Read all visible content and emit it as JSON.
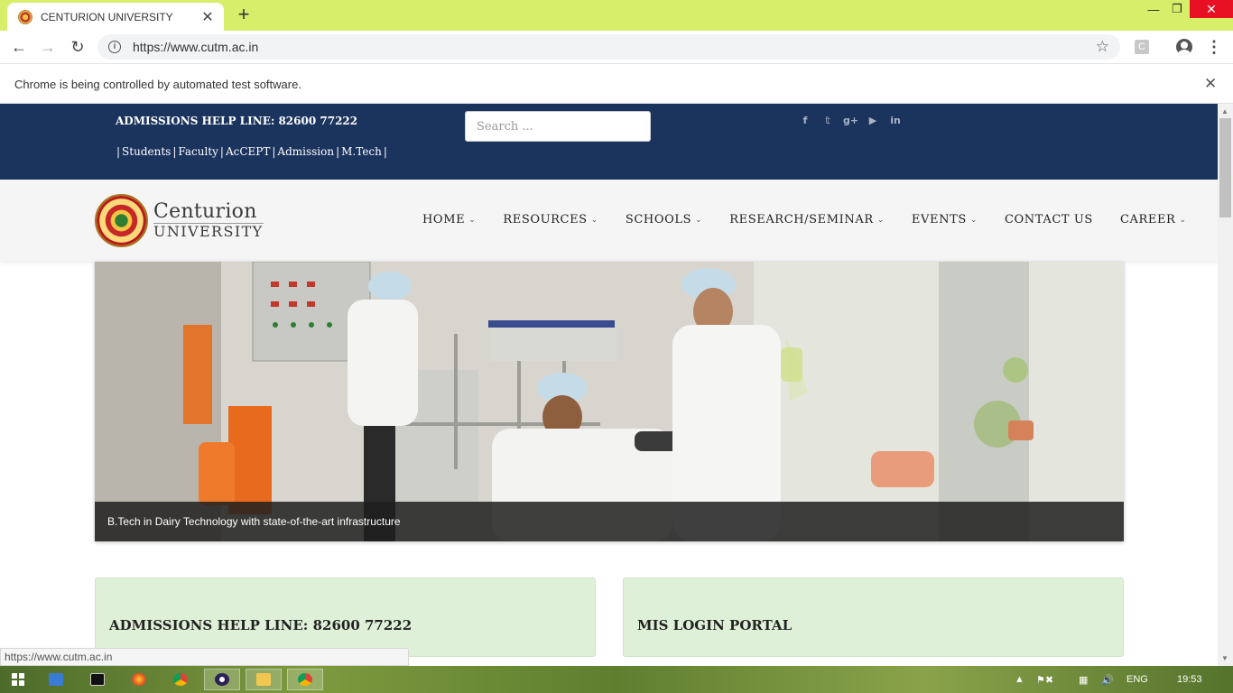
{
  "browser": {
    "tab_title": "CENTURION UNIVERSITY",
    "tab_close": "✕",
    "new_tab": "+",
    "url": "https://www.cutm.ac.in",
    "infobar_text": "Chrome is being controlled by automated test software.",
    "status_url": "https://www.cutm.ac.in",
    "extension_letter": "C"
  },
  "site": {
    "helpline": "ADMISSIONS HELP LINE: 82600 77222",
    "quick_links": [
      "Students",
      "Faculty",
      "AcCEPT",
      "Admission",
      "M.Tech"
    ],
    "search_placeholder": "Search ...",
    "social_icons": [
      "facebook-icon",
      "twitter-icon",
      "google-plus-icon",
      "youtube-icon",
      "linkedin-icon"
    ],
    "logo": {
      "line1": "Centurion",
      "line2": "UNIVERSITY"
    },
    "menu": [
      "HOME",
      "RESOURCES",
      "SCHOOLS",
      "RESEARCH/SEMINAR",
      "EVENTS",
      "CONTACT US",
      "CAREER"
    ],
    "menu_has_dropdown": [
      true,
      true,
      true,
      true,
      true,
      false,
      true
    ],
    "hero_caption": "B.Tech in Dairy Technology with state-of-the-art infrastructure",
    "cards": [
      {
        "title": "ADMISSIONS HELP LINE: 82600 77222"
      },
      {
        "title": "MIS LOGIN PORTAL"
      }
    ],
    "colors": {
      "topbar": "#1b345e",
      "card_bg": "#dff0d8"
    }
  },
  "taskbar": {
    "language": "ENG",
    "clock": "19:53"
  }
}
